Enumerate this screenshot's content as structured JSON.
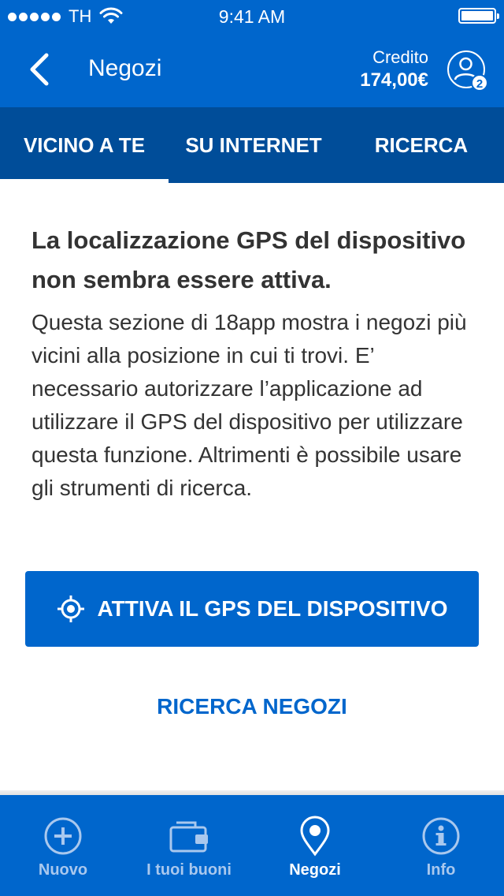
{
  "status_bar": {
    "carrier": "TH",
    "time": "9:41 AM"
  },
  "header": {
    "title": "Negozi",
    "credit_label": "Credito",
    "credit_value": "174,00€",
    "profile_badge": "2"
  },
  "tabs": [
    {
      "label": "VICINO A TE",
      "active": true
    },
    {
      "label": "SU INTERNET",
      "active": false
    },
    {
      "label": "RICERCA",
      "active": false
    }
  ],
  "content": {
    "headline": "La localizzazione GPS  del dispositivo non sembra essere attiva.",
    "body": "Questa sezione di 18app mostra i negozi più vicini alla posizione in cui ti trovi. E’ necessario autorizzare l’applicazione ad utilizzare il GPS del dispositivo per utilizzare questa funzione. Altrimenti è possibile usare gli strumenti di ricerca.",
    "gps_button_label": "ATTIVA IL GPS DEL DISPOSITIVO",
    "search_link_label": "RICERCA NEGOZI"
  },
  "bottom_nav": [
    {
      "label": "Nuovo",
      "icon": "plus-circle-icon",
      "active": false
    },
    {
      "label": "I tuoi buoni",
      "icon": "wallet-icon",
      "active": false
    },
    {
      "label": "Negozi",
      "icon": "map-pin-icon",
      "active": true
    },
    {
      "label": "Info",
      "icon": "info-circle-icon",
      "active": false
    }
  ],
  "colors": {
    "primary": "#0066cc",
    "tab_bar": "#004d99",
    "text": "#333333",
    "inactive_nav": "#a9c8ee"
  }
}
